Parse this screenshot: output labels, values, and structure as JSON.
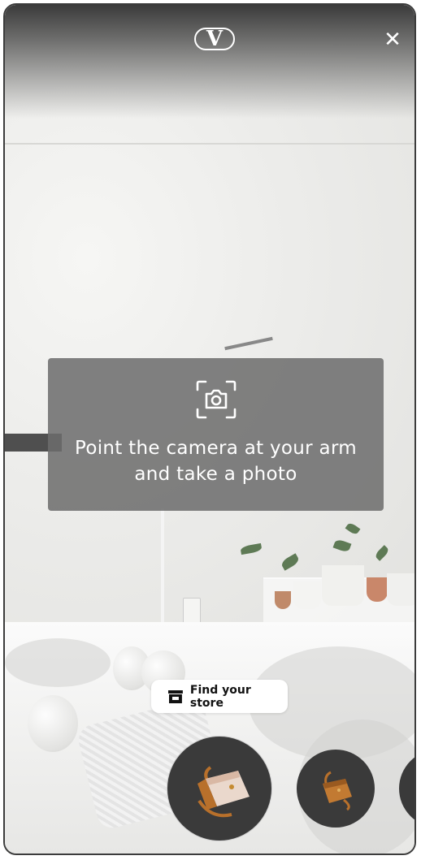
{
  "header": {
    "logo_text": "V",
    "close_glyph": "✕"
  },
  "hint": {
    "line1": "Point the camera at your arm",
    "line2": "and take a photo",
    "icon": "camera-focus-icon"
  },
  "store_button": {
    "label": "Find your store",
    "icon": "store-icon"
  },
  "products": [
    {
      "name": "bag-product-1",
      "selected": true
    },
    {
      "name": "bag-product-2",
      "selected": false
    },
    {
      "name": "bag-product-3",
      "selected": false
    }
  ],
  "colors": {
    "overlay": "#6c6c6c",
    "bag_tan": "#b8702b",
    "bag_cream": "#ead8cc",
    "product_bg": "#3a3a3a"
  }
}
